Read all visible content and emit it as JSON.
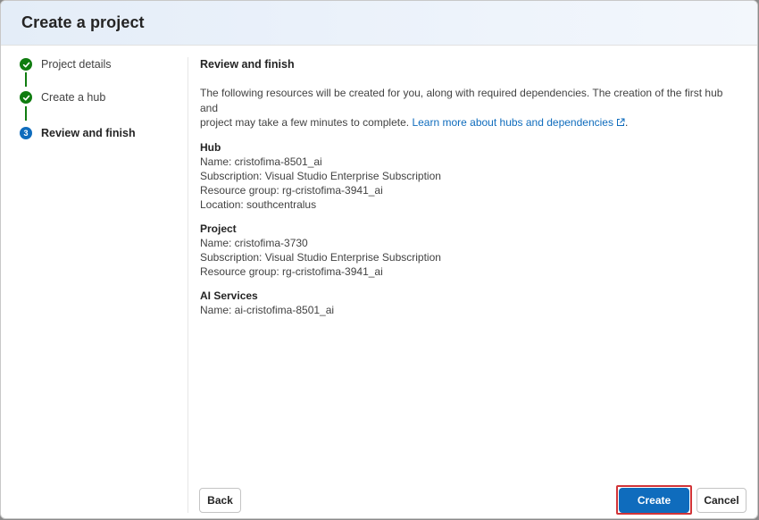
{
  "dialog": {
    "title": "Create a project"
  },
  "steps": [
    {
      "label": "Project details",
      "status": "done"
    },
    {
      "label": "Create a hub",
      "status": "done"
    },
    {
      "label": "Review and finish",
      "status": "current",
      "number": "3"
    }
  ],
  "review": {
    "heading": "Review and finish",
    "intro_line1": "The following resources will be created for you, along with required dependencies. The creation of the first hub and",
    "intro_line2": "project may take a few minutes to complete.",
    "learn_more": "Learn more about hubs and dependencies",
    "period": ".",
    "hub": {
      "title": "Hub",
      "name": "Name: cristofima-8501_ai",
      "subscription": "Subscription: Visual Studio Enterprise Subscription",
      "resource_group": "Resource group: rg-cristofima-3941_ai",
      "location": "Location: southcentralus"
    },
    "project": {
      "title": "Project",
      "name": "Name: cristofima-3730",
      "subscription": "Subscription: Visual Studio Enterprise Subscription",
      "resource_group": "Resource group: rg-cristofima-3941_ai"
    },
    "ai_services": {
      "title": "AI Services",
      "name": "Name: ai-cristofima-8501_ai"
    }
  },
  "footer": {
    "back": "Back",
    "create": "Create",
    "cancel": "Cancel"
  },
  "colors": {
    "accent": "#0f6cbd",
    "success": "#107c10",
    "focus": "#d13438"
  },
  "icons": [
    "checkmark-icon",
    "external-link-icon"
  ]
}
